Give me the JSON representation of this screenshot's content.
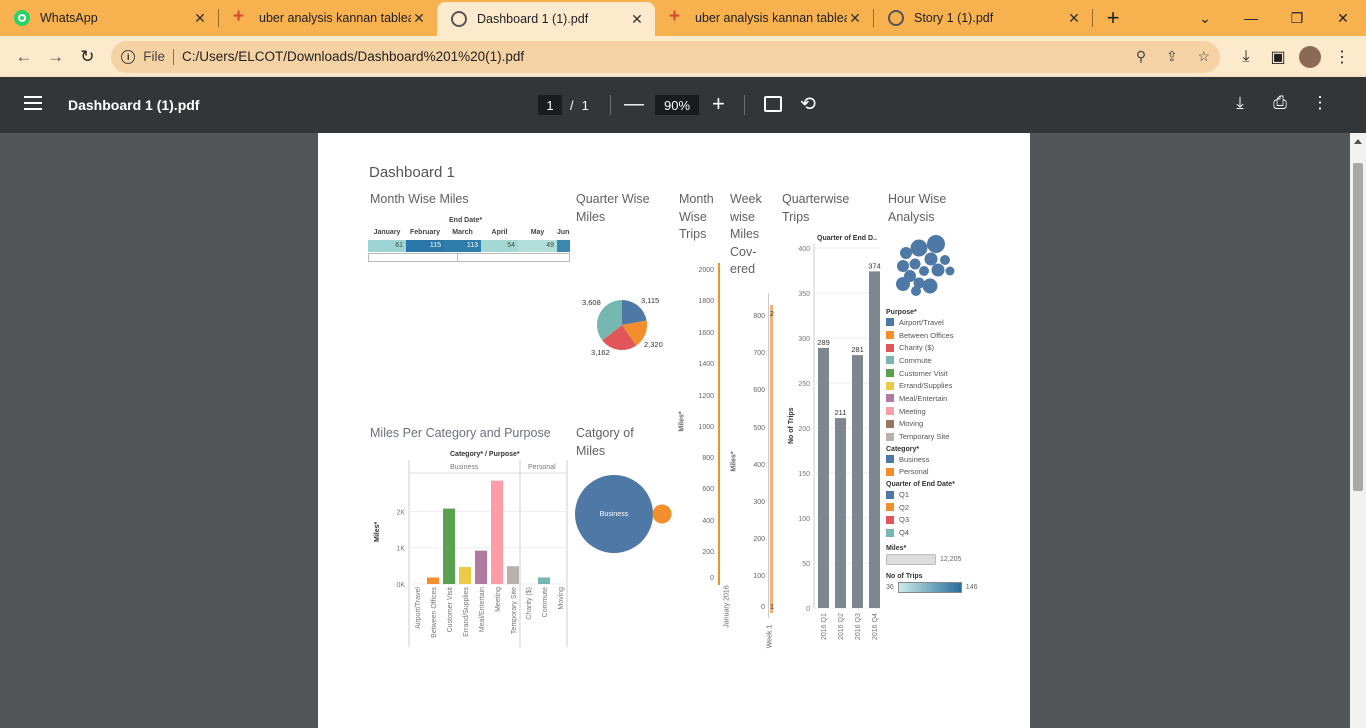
{
  "tabs": [
    {
      "title": "WhatsApp",
      "icon": "whatsapp-icon",
      "active": false
    },
    {
      "title": "uber analysis kannan tableau",
      "icon": "tableau-icon",
      "active": false
    },
    {
      "title": "Dashboard 1 (1).pdf",
      "icon": "globe-icon",
      "active": true
    },
    {
      "title": "uber analysis kannan tableau",
      "icon": "tableau-icon",
      "active": false
    },
    {
      "title": "Story 1 (1).pdf",
      "icon": "globe-icon",
      "active": false
    }
  ],
  "address": {
    "scheme_label": "File",
    "url": "C:/Users/ELCOT/Downloads/Dashboard%201%20(1).pdf"
  },
  "pdf": {
    "title": "Dashboard 1 (1).pdf",
    "page_current": "1",
    "page_sep": "/",
    "page_total": "1",
    "zoom": "90%"
  },
  "dashboard": {
    "title": "Dashboard 1",
    "month_wise_miles": {
      "title": "Month Wise Miles",
      "header": "End Date*",
      "months": [
        "January",
        "February",
        "March",
        "April",
        "May",
        "Jun"
      ],
      "values": [
        "61",
        "115",
        "113",
        "54",
        "49",
        ""
      ]
    },
    "quarter_wise_miles": {
      "title_line1": "Quarter Wise",
      "title_line2": "Miles",
      "labels": [
        "3,608",
        "3,115",
        "2,320",
        "3,162"
      ]
    },
    "month_wise_trips": {
      "title_line1": "Month",
      "title_line2": "Wise",
      "title_line3": "Trips",
      "y_label": "Miles*",
      "ticks": [
        "2000",
        "1800",
        "1600",
        "1400",
        "1200",
        "1000",
        "800",
        "600",
        "400",
        "200",
        "0"
      ],
      "x_tick": "January 2016"
    },
    "week_wise_miles": {
      "title_line1": "Week",
      "title_line2": "wise",
      "title_line3": "Miles",
      "title_line4": "Cov-",
      "title_line5": "ered",
      "y_label": "Miles*",
      "ticks": [
        "800",
        "700",
        "600",
        "500",
        "400",
        "300",
        "200",
        "100",
        "0"
      ],
      "x_tick": "Week 1",
      "bar_label": "2",
      "zero_label": "1"
    },
    "quarterwise_trips": {
      "title_line1": "Quarterwise",
      "title_line2": "Trips",
      "header": "Quarter of End D..",
      "y_label": "No of Trips",
      "ticks": [
        "400",
        "350",
        "300",
        "250",
        "200",
        "150",
        "100",
        "50",
        "0"
      ],
      "categories": [
        "2016 Q1",
        "2016 Q2",
        "2016 Q3",
        "2016 Q4"
      ],
      "values": [
        289,
        211,
        281,
        374
      ],
      "value_labels": [
        "289",
        "211",
        "281",
        "374"
      ]
    },
    "hour_wise": {
      "title_line1": "Hour Wise",
      "title_line2": "Analysis",
      "purpose_header": "Purpose*",
      "purposes": [
        {
          "label": "Airport/Travel",
          "color": "#4e79a7"
        },
        {
          "label": "Between Offices",
          "color": "#f28e2b"
        },
        {
          "label": "Charity ($)",
          "color": "#e15759"
        },
        {
          "label": "Commute",
          "color": "#76b7b2"
        },
        {
          "label": "Customer Visit",
          "color": "#59a14f"
        },
        {
          "label": "Errand/Supplies",
          "color": "#edc948"
        },
        {
          "label": "Meal/Entertain",
          "color": "#b07aa1"
        },
        {
          "label": "Meeting",
          "color": "#ff9da7"
        },
        {
          "label": "Moving",
          "color": "#9c755f"
        },
        {
          "label": "Temporary Site",
          "color": "#bab0ac"
        }
      ],
      "category_header": "Category*",
      "categories": [
        {
          "label": "Business",
          "color": "#4e79a7"
        },
        {
          "label": "Personal",
          "color": "#f28e2b"
        }
      ],
      "quarter_header": "Quarter of End Date*",
      "quarters": [
        {
          "label": "Q1",
          "color": "#4e79a7"
        },
        {
          "label": "Q2",
          "color": "#f28e2b"
        },
        {
          "label": "Q3",
          "color": "#e15759"
        },
        {
          "label": "Q4",
          "color": "#76b7b2"
        }
      ],
      "miles_header": "Miles*",
      "miles_max": "12,205",
      "trips_header": "No of Trips",
      "trips_min": "36",
      "trips_max": "146"
    },
    "miles_per_category": {
      "title": "Miles Per Category and Purpose",
      "header": "Category* / Purpose*",
      "group_business": "Business",
      "group_personal": "Personal",
      "y_label": "Miles*",
      "ticks": [
        "2K",
        "1K",
        "0K"
      ],
      "business_labels": [
        "Airport/Travel",
        "Between Offices",
        "Customer Visit",
        "Errand/Supplies",
        "Meal/Entertain",
        "Meeting",
        "Temporary Site"
      ],
      "business_values": [
        0,
        180,
        2080,
        470,
        920,
        2850,
        490
      ],
      "personal_labels": [
        "Charity ($)",
        "Commute",
        "Moving"
      ],
      "personal_values": [
        0,
        180,
        0
      ]
    },
    "category_of_miles": {
      "title_line1": "Catgory of",
      "title_line2": "Miles",
      "bubble_label": "Business"
    }
  }
}
